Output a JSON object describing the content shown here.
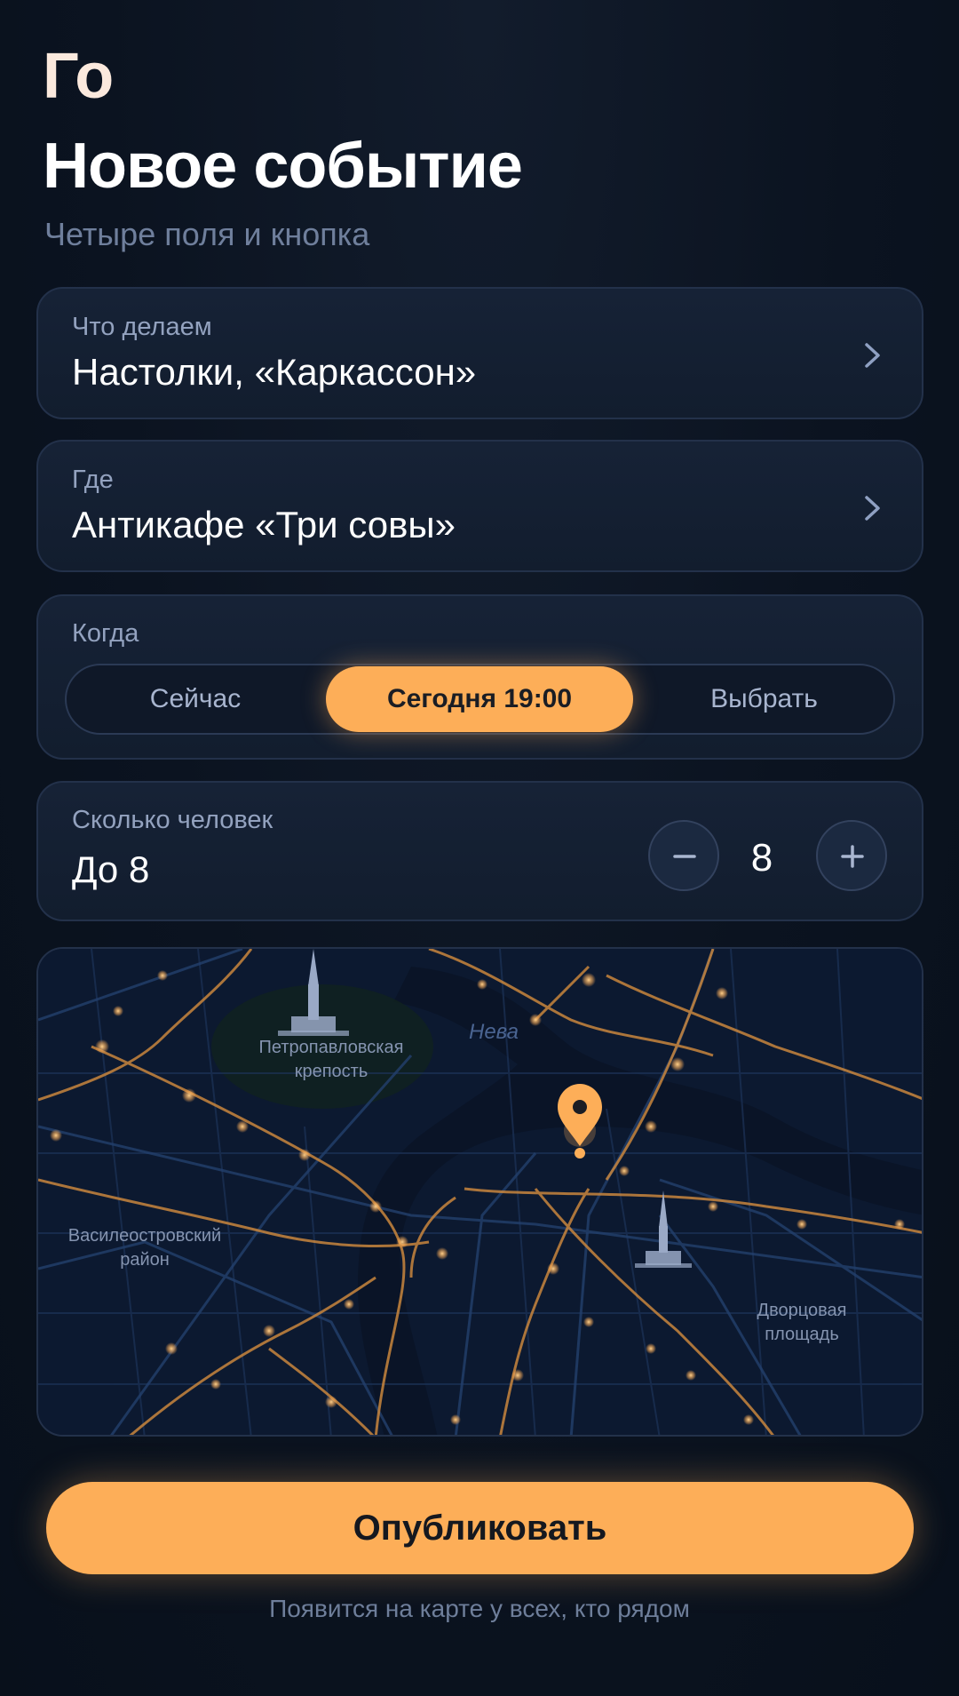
{
  "app": {
    "logo": "Го"
  },
  "header": {
    "title": "Новое событие",
    "subtitle": "Четыре поля и кнопка"
  },
  "fields": {
    "what": {
      "label": "Что делаем",
      "value": "Настолки, «Каркассон»"
    },
    "where": {
      "label": "Где",
      "value": "Антикафе «Три совы»"
    },
    "when": {
      "label": "Когда",
      "options": [
        "Сейчас",
        "Сегодня 19:00",
        "Выбрать"
      ],
      "selected": "Сегодня 19:00"
    },
    "people": {
      "label": "Сколько человек",
      "value": "До 8",
      "count": "8"
    }
  },
  "map": {
    "labels": {
      "fortress": "Петропавловская\nкрепость",
      "river": "Нева",
      "district": "Василеостровский\nрайон",
      "square": "Дворцовая\nплощадь"
    },
    "icons": [
      "pin-icon",
      "spire-icon"
    ]
  },
  "actions": {
    "publish_label": "Опубликовать",
    "note": "Появится на карте у всех, кто рядом"
  },
  "colors": {
    "accent": "#fdae58",
    "background": "#0b1320",
    "card": "#141f31",
    "muted_text": "#93a2bf"
  }
}
